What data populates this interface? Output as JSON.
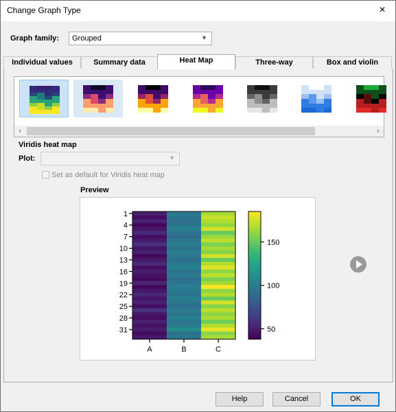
{
  "window": {
    "title": "Change Graph Type",
    "close_icon": "×"
  },
  "graph_family": {
    "label": "Graph family:",
    "value": "Grouped"
  },
  "tabs": [
    {
      "label": "Individual values",
      "active": false
    },
    {
      "label": "Summary data",
      "active": false
    },
    {
      "label": "Heat Map",
      "active": true
    },
    {
      "label": "Three-way",
      "active": false
    },
    {
      "label": "Box and violin",
      "active": false
    }
  ],
  "gallery": {
    "palettes": [
      {
        "name": "viridis",
        "selected": true,
        "colors": [
          "#3b1e6b",
          "#2f2b78",
          "#26497a",
          "#1e7e79",
          "#2aa37a",
          "#8fcf45",
          "#c8df2a",
          "#fde725"
        ]
      },
      {
        "name": "magma",
        "selected": false,
        "hover": true,
        "colors": [
          "#0c0826",
          "#3b0f6f",
          "#8c2981",
          "#dd4968",
          "#fd9f6c",
          "#fcecb0"
        ]
      },
      {
        "name": "inferno",
        "selected": false,
        "colors": [
          "#000004",
          "#420a68",
          "#932667",
          "#dd513a",
          "#fca50a",
          "#fcffa4"
        ]
      },
      {
        "name": "plasma",
        "selected": false,
        "colors": [
          "#2b0a5e",
          "#6a00a8",
          "#b12a90",
          "#e16462",
          "#fca636",
          "#f0f921"
        ]
      },
      {
        "name": "grays",
        "selected": false,
        "colors": [
          "#111111",
          "#3a3a3a",
          "#646464",
          "#8f8f8f",
          "#bdbdbd",
          "#e6e6e6"
        ]
      },
      {
        "name": "blues",
        "selected": false,
        "colors": [
          "#ffffff",
          "#d2e2f6",
          "#9ac0ee",
          "#5a9aea",
          "#2f7de0",
          "#1c6ad6"
        ]
      },
      {
        "name": "red-green",
        "selected": false,
        "colors": [
          "#1ea83a",
          "#0f4f1c",
          "#000000",
          "#5a0d0d",
          "#b51f1f",
          "#e12b2b"
        ]
      }
    ],
    "scroll_left_icon": "‹",
    "scroll_right_icon": "›"
  },
  "plot_section": {
    "heading": "Viridis heat map",
    "plot_label": "Plot:",
    "plot_value": "",
    "default_checkbox_label": "Set as default for Viridis heat map"
  },
  "preview": {
    "heading": "Preview",
    "chart_data": {
      "type": "heatmap",
      "columns": [
        "A",
        "B",
        "C"
      ],
      "row_tick_labels": [
        "1",
        "4",
        "7",
        "10",
        "13",
        "16",
        "19",
        "22",
        "25",
        "28",
        "31"
      ],
      "row_count": 33,
      "colorbar": {
        "min": 38,
        "max": 185,
        "ticks": [
          50,
          100,
          150
        ]
      },
      "values": [
        [
          50,
          98,
          165
        ],
        [
          44,
          95,
          172
        ],
        [
          52,
          92,
          168
        ],
        [
          40,
          96,
          160
        ],
        [
          47,
          101,
          175
        ],
        [
          55,
          94,
          150
        ],
        [
          43,
          90,
          162
        ],
        [
          49,
          97,
          170
        ],
        [
          58,
          99,
          155
        ],
        [
          46,
          93,
          165
        ],
        [
          52,
          100,
          158
        ],
        [
          41,
          96,
          175
        ],
        [
          48,
          91,
          150
        ],
        [
          56,
          98,
          168
        ],
        [
          44,
          103,
          178
        ],
        [
          50,
          94,
          160
        ],
        [
          45,
          99,
          170
        ],
        [
          42,
          92,
          155
        ],
        [
          53,
          95,
          165
        ],
        [
          40,
          100,
          185
        ],
        [
          48,
          97,
          160
        ],
        [
          55,
          93,
          168
        ],
        [
          46,
          101,
          150
        ],
        [
          51,
          96,
          175
        ],
        [
          44,
          91,
          158
        ],
        [
          60,
          99,
          170
        ],
        [
          47,
          94,
          160
        ],
        [
          43,
          102,
          166
        ],
        [
          52,
          95,
          152
        ],
        [
          45,
          98,
          168
        ],
        [
          50,
          110,
          180
        ],
        [
          42,
          93,
          158
        ],
        [
          48,
          96,
          165
        ]
      ]
    }
  },
  "buttons": {
    "help": "Help",
    "cancel": "Cancel",
    "ok": "OK"
  }
}
